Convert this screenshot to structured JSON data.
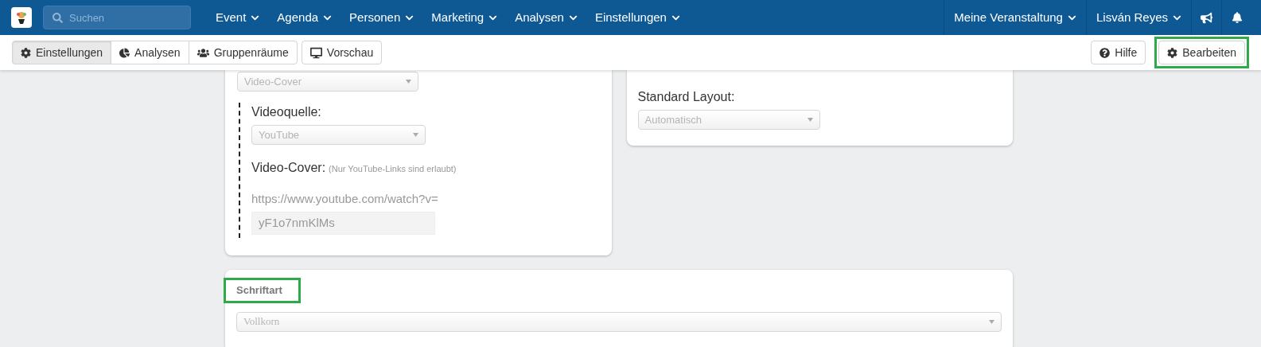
{
  "topbar": {
    "search": {
      "placeholder": "Suchen"
    },
    "menu": [
      {
        "label": "Event"
      },
      {
        "label": "Agenda"
      },
      {
        "label": "Personen"
      },
      {
        "label": "Marketing"
      },
      {
        "label": "Analysen"
      },
      {
        "label": "Einstellungen"
      }
    ],
    "right_menu": [
      {
        "label": "Meine Veranstaltung"
      },
      {
        "label": "Lisván Reyes"
      }
    ]
  },
  "toolbar": {
    "tabs": [
      {
        "label": "Einstellungen",
        "kind": "gear",
        "selected": true
      },
      {
        "label": "Analysen",
        "kind": "pie",
        "selected": false
      },
      {
        "label": "Gruppenräume",
        "kind": "users",
        "selected": false
      }
    ],
    "preview": {
      "label": "Vorschau"
    },
    "help": {
      "label": "Hilfe",
      "highlighted": false
    },
    "edit": {
      "label": "Bearbeiten",
      "highlighted": true
    }
  },
  "left_card": {
    "cover_select": {
      "value": "Video-Cover"
    },
    "source_label": "Videoquelle:",
    "source_select": {
      "value": "YouTube"
    },
    "cover_label": "Video-Cover:",
    "cover_hint": "(Nur YouTube-Links sind erlaubt)",
    "url_prefix": "https://www.youtube.com/watch?v=",
    "video_id": {
      "value": "yF1o7nmKlMs"
    }
  },
  "right_card": {
    "layout_label": "Standard Layout:",
    "layout_select": {
      "value": "Automatisch"
    }
  },
  "font_card": {
    "label": "Schriftart",
    "highlighted": true,
    "select": {
      "value": "Vollkorn"
    }
  }
}
